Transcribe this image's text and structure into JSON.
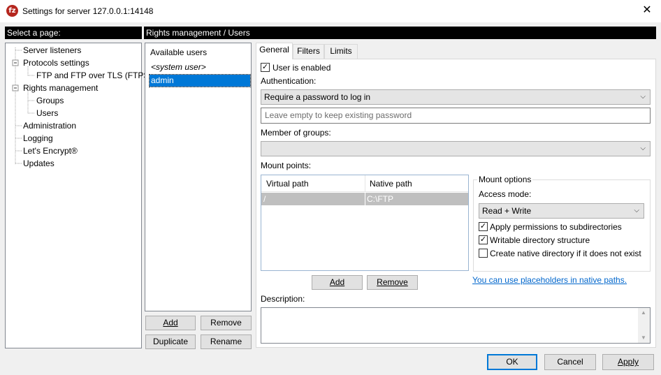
{
  "window": {
    "title": "Settings for server 127.0.0.1:14148",
    "icon_glyph": "fz"
  },
  "left_header": "Select a page:",
  "right_header": "Rights management / Users",
  "tree": {
    "items": [
      {
        "label": "Server listeners"
      },
      {
        "label": "Protocols settings",
        "expander": "−"
      },
      {
        "label": "FTP and FTP over TLS (FTPS)"
      },
      {
        "label": "Rights management",
        "expander": "−"
      },
      {
        "label": "Groups"
      },
      {
        "label": "Users"
      },
      {
        "label": "Administration"
      },
      {
        "label": "Logging"
      },
      {
        "label": "Let's Encrypt®"
      },
      {
        "label": "Updates"
      }
    ]
  },
  "users": {
    "heading": "Available users",
    "items": [
      "<system user>",
      "admin"
    ],
    "selected": "admin",
    "buttons": {
      "add": "Add",
      "remove": "Remove",
      "duplicate": "Duplicate",
      "rename": "Rename"
    }
  },
  "tabs": [
    "General",
    "Filters",
    "Limits"
  ],
  "general": {
    "user_enabled_label": "User is enabled",
    "user_enabled": true,
    "authentication_label": "Authentication:",
    "authentication_value": "Require a password to log in",
    "password_placeholder": "Leave empty to keep existing password",
    "member_of_groups_label": "Member of groups:",
    "member_of_groups_value": "",
    "mount_points_label": "Mount points:",
    "mount_table": {
      "columns": [
        "Virtual path",
        "Native path"
      ],
      "rows": [
        [
          "/",
          "C:\\FTP"
        ]
      ]
    },
    "mount_add": "Add",
    "mount_remove": "Remove",
    "mount_options": {
      "title": "Mount options",
      "access_mode_label": "Access mode:",
      "access_mode_value": "Read + Write",
      "apply_permissions_label": "Apply permissions to subdirectories",
      "apply_permissions": true,
      "writable_structure_label": "Writable directory structure",
      "writable_structure": true,
      "create_native_label": "Create native directory if it does not exist",
      "create_native": false
    },
    "placeholders_link": "You can use placeholders in native paths.",
    "description_label": "Description:",
    "description_value": ""
  },
  "footer": {
    "ok": "OK",
    "cancel": "Cancel",
    "apply": "Apply"
  },
  "colors": {
    "selection": "#0078d7",
    "link": "#0066cc",
    "header_bg": "#000000"
  }
}
